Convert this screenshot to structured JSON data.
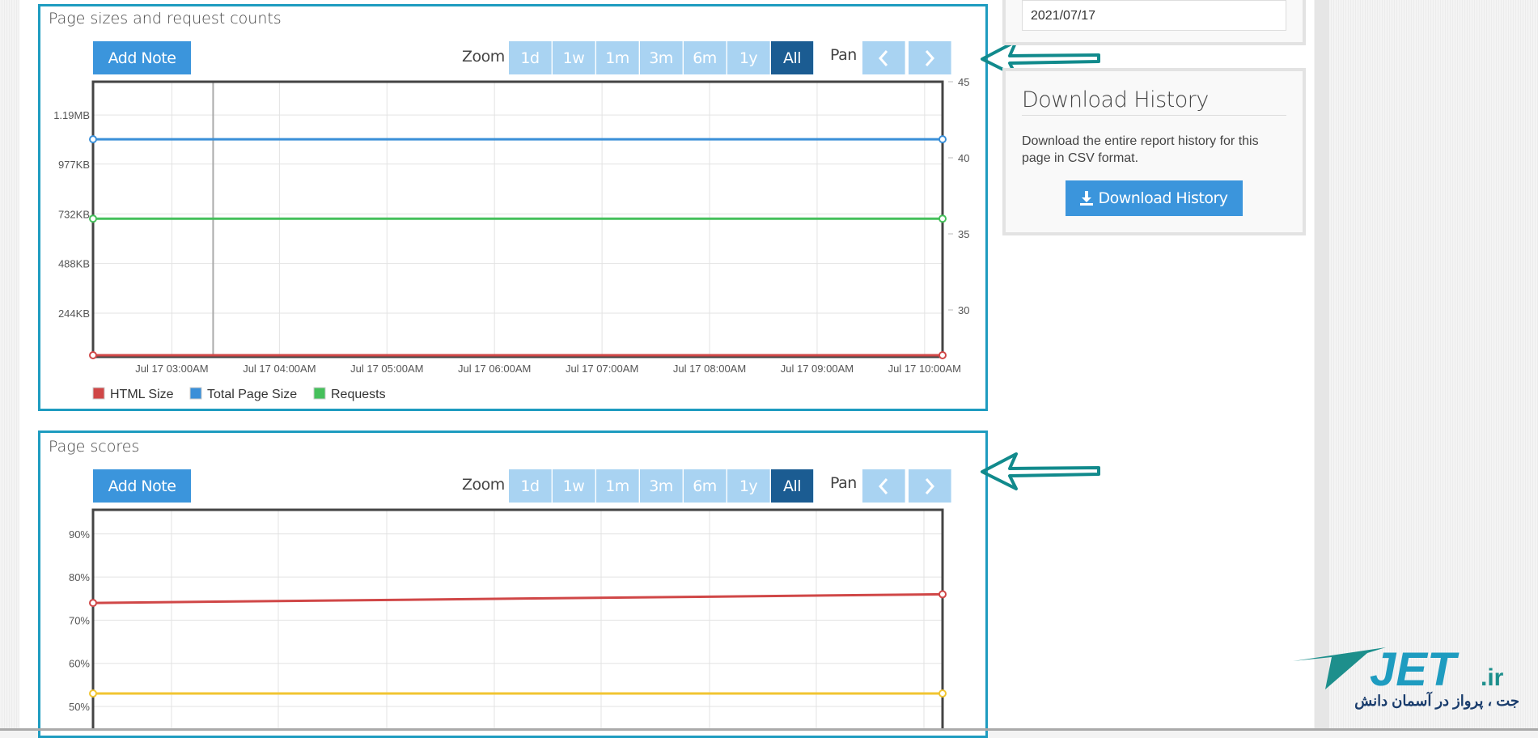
{
  "colors": {
    "accent": "#3b95dc",
    "active_zoom": "#1b5c92",
    "zoom_btn": "#a9d3f2",
    "panel_border": "#1e9cc0",
    "arrow": "#118a8c",
    "html": "#d04747",
    "total": "#3a8fd8",
    "requests": "#45c05b",
    "score_red": "#d04747",
    "score_yellow": "#f2c531"
  },
  "controls": {
    "add_note": "Add Note",
    "zoom_label": "Zoom",
    "zoom_options": [
      "1d",
      "1w",
      "1m",
      "3m",
      "6m",
      "1y",
      "All"
    ],
    "zoom_selected": "All",
    "pan_label": "Pan",
    "pan_prev_icon": "chevron-left-icon",
    "pan_next_icon": "chevron-right-icon"
  },
  "sidebar": {
    "date_value": "2021/07/17",
    "download": {
      "heading": "Download History",
      "text_line1": "Download the entire report history for this",
      "text_line2": "page in CSV format.",
      "button_label": "Download History",
      "button_icon": "download-icon"
    }
  },
  "logo": {
    "text": "JET.ir",
    "tagline": "جت ، پرواز در آسمان دانش"
  },
  "chart_data": [
    {
      "type": "line",
      "title": "Page sizes and request counts",
      "x": [
        "Jul 17 02:16AM",
        "Jul 17 10:10AM"
      ],
      "xticks": [
        "Jul 17 03:00AM",
        "Jul 17 04:00AM",
        "Jul 17 05:00AM",
        "Jul 17 06:00AM",
        "Jul 17 07:00AM",
        "Jul 17 08:00AM",
        "Jul 17 09:00AM",
        "Jul 17 10:00AM"
      ],
      "yticks_left": [
        "244KB",
        "488KB",
        "732KB",
        "977KB",
        "1.19MB"
      ],
      "yticks_right": [
        "30",
        "35",
        "40",
        "45"
      ],
      "plot_line": "Jul 17 03:23AM",
      "grid": true,
      "legend": "bottom-left",
      "series": [
        {
          "name": "HTML Size",
          "axis": "left",
          "unit": "KB",
          "values": [
            37,
            37
          ]
        },
        {
          "name": "Total Page Size",
          "axis": "left",
          "unit": "KB",
          "values": [
            1099,
            1099
          ]
        },
        {
          "name": "Requests",
          "axis": "right",
          "values": [
            36,
            36
          ]
        }
      ]
    },
    {
      "type": "line",
      "title": "Page scores",
      "x": [
        "Jul 17 02:16AM",
        "Jul 17 10:10AM"
      ],
      "yticks_left": [
        "50%",
        "60%",
        "70%",
        "80%",
        "90%"
      ],
      "grid": true,
      "series": [
        {
          "values": [
            74,
            76
          ]
        },
        {
          "values": [
            53,
            53
          ]
        }
      ]
    }
  ]
}
